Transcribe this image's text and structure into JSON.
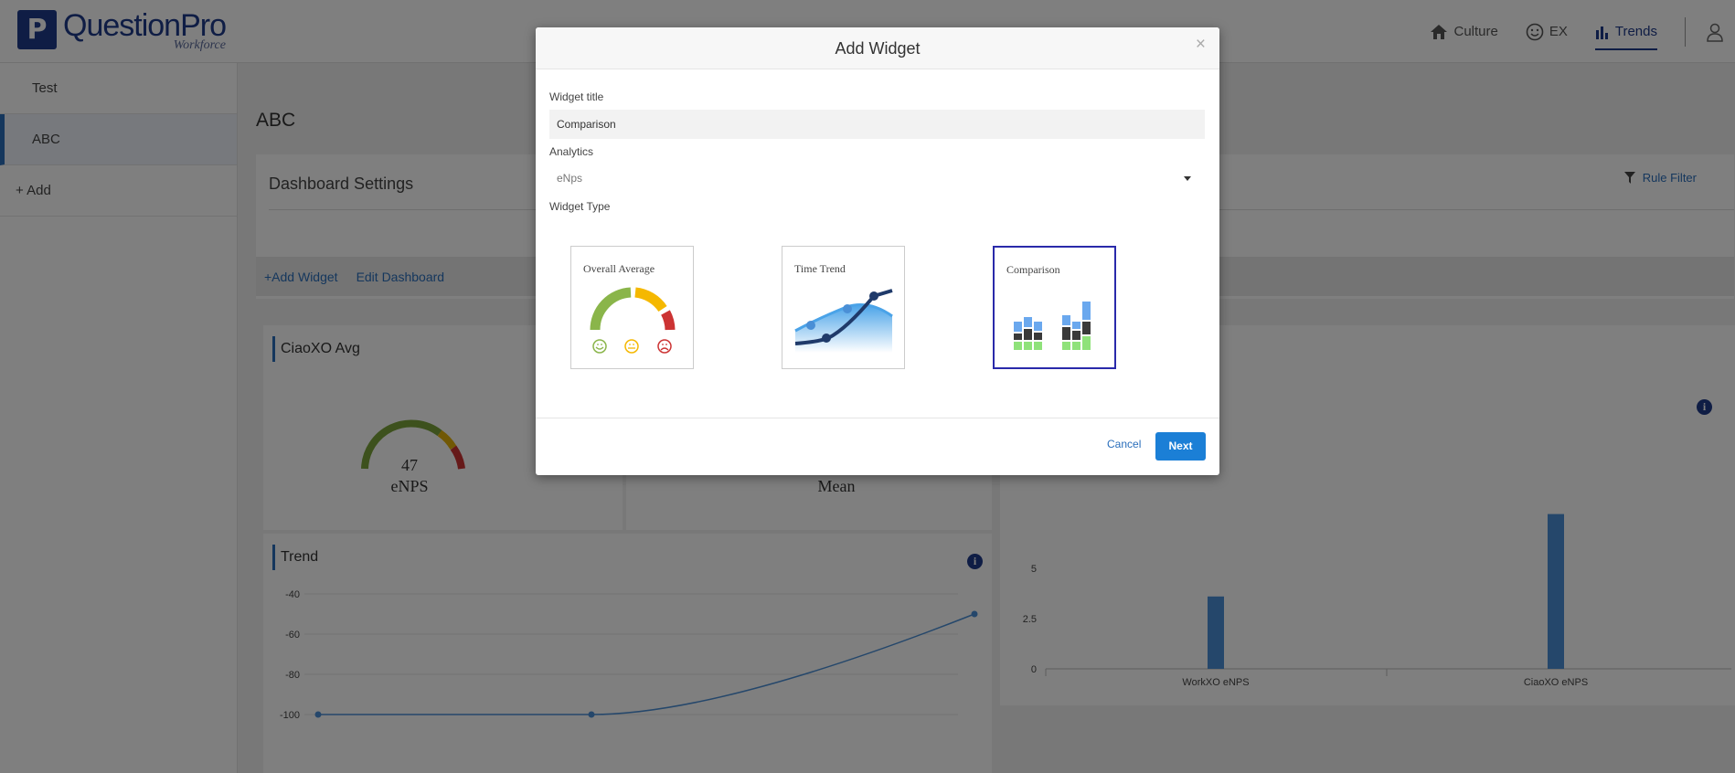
{
  "brand": {
    "name": "QuestionPro",
    "sub": "Workforce",
    "badge": "P"
  },
  "topnav": {
    "culture": "Culture",
    "ex": "EX",
    "trends": "Trends"
  },
  "sidebar": {
    "items": [
      {
        "label": "Test"
      },
      {
        "label": "ABC"
      }
    ],
    "add_label": "+ Add"
  },
  "main": {
    "title": "ABC",
    "settings_title": "Dashboard Settings",
    "rule_filter": "Rule Filter",
    "add_widget": "+Add Widget",
    "edit_dashboard": "Edit Dashboard"
  },
  "widgets": {
    "avg": {
      "title": "CiaoXO Avg",
      "value": "47",
      "unit": "eNPS",
      "mean_label": "Mean"
    },
    "trend": {
      "title": "Trend",
      "y_ticks": [
        "-40",
        "-60",
        "-80",
        "-100"
      ],
      "points": [
        -100,
        -100,
        -50
      ]
    },
    "compare": {
      "y_ticks": [
        "5",
        "2.5",
        "0"
      ],
      "categories": [
        "WorkXO eNPS",
        "CiaoXO eNPS"
      ],
      "values": [
        3.6,
        7.7
      ]
    }
  },
  "modal": {
    "title": "Add Widget",
    "close": "×",
    "widget_title_label": "Widget title",
    "widget_title_value": "Comparison",
    "analytics_label": "Analytics",
    "analytics_value": "eNps",
    "widget_type_label": "Widget Type",
    "types": [
      {
        "label": "Overall Average"
      },
      {
        "label": "Time Trend"
      },
      {
        "label": "Comparison"
      }
    ],
    "selected_type": "Comparison",
    "cancel": "Cancel",
    "next": "Next"
  },
  "colors": {
    "brand": "#1f3a8a",
    "accent": "#2a6ebb",
    "primary_button": "#1b7fd6"
  }
}
